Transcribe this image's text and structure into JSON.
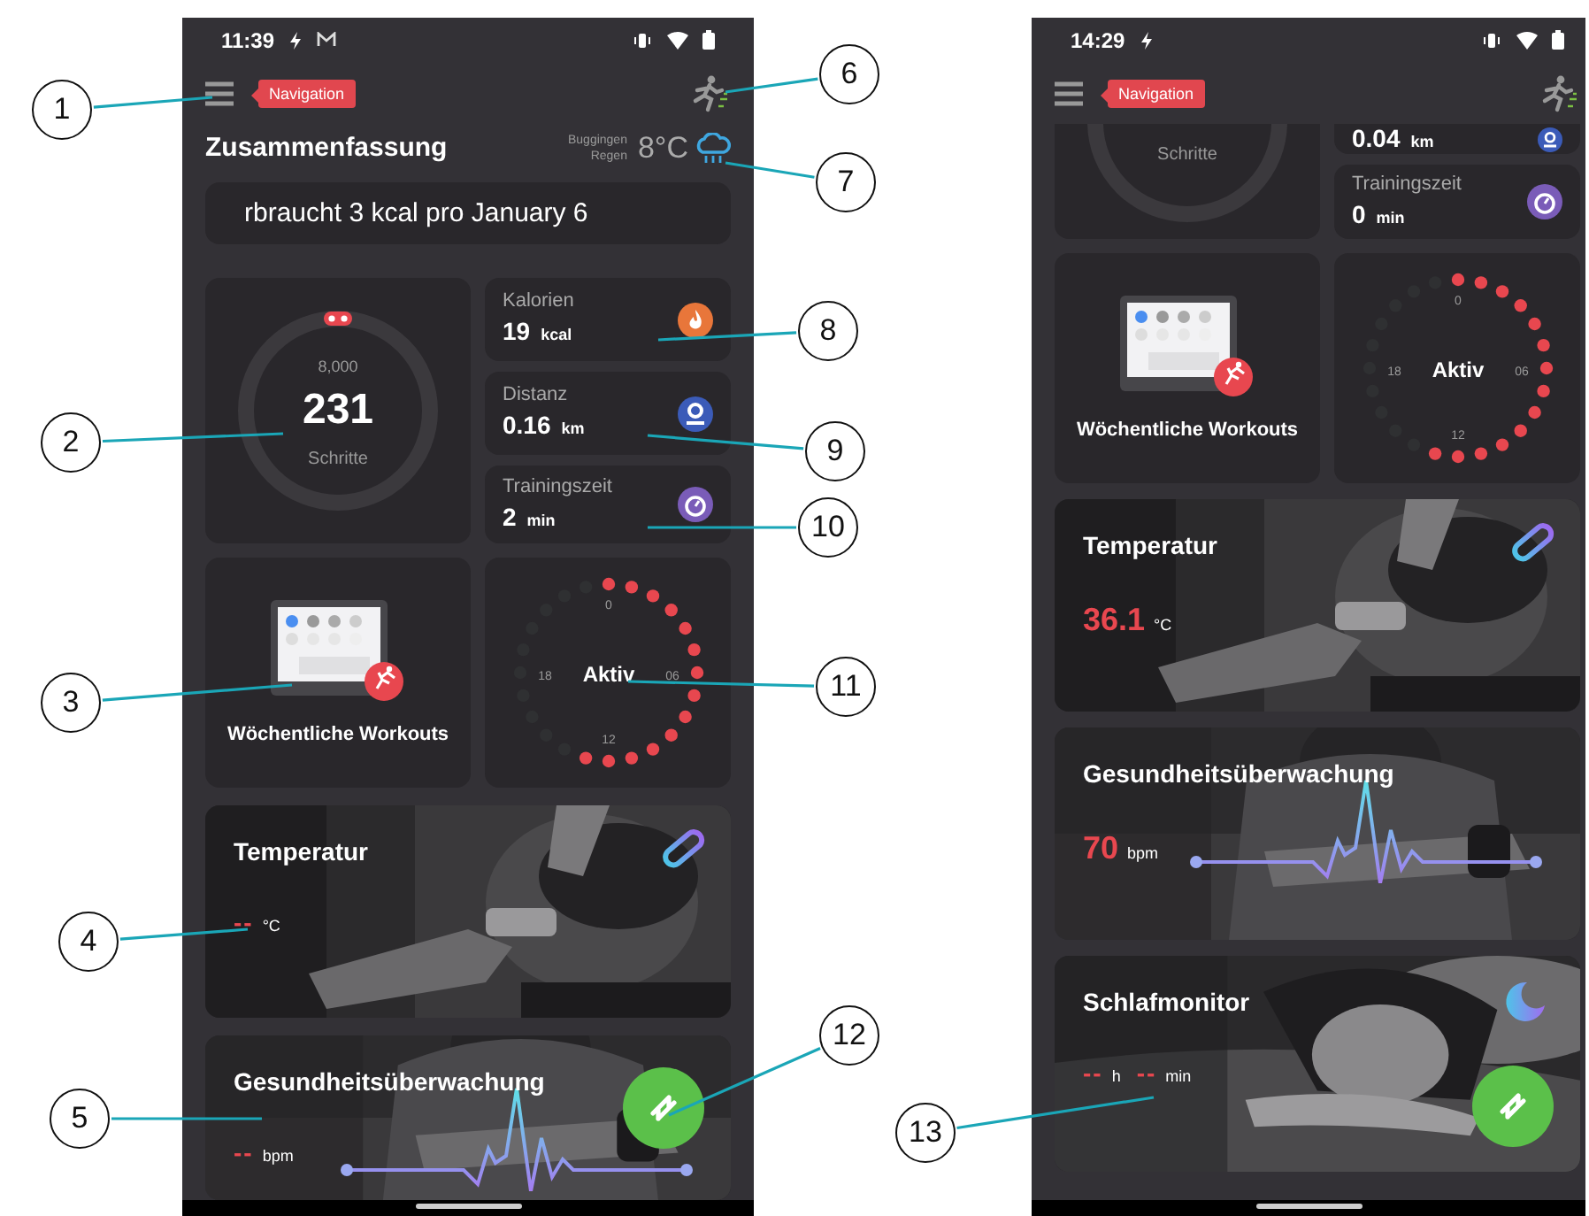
{
  "screens": [
    {
      "status_bar": {
        "time": "11:39",
        "mail_notification": true
      },
      "header": {
        "navigation_hint": "Navigation"
      },
      "title": "Zusammenfassung",
      "weather": {
        "location": "Buggingen",
        "condition": "Regen",
        "temperature": "8°C"
      },
      "banner": "rbraucht 3 kcal pro January 6",
      "summary": {
        "kind": "full",
        "steps": {
          "goal": "8,000",
          "value": "231",
          "label": "Schritte",
          "marker": true
        },
        "metrics": [
          {
            "kind": "calories",
            "label": "Kalorien",
            "value": "19",
            "unit": "kcal"
          },
          {
            "kind": "distance",
            "label": "Distanz",
            "value": "0.16",
            "unit": "km"
          },
          {
            "kind": "duration",
            "label": "Trainingszeit",
            "value": "2",
            "unit": "min"
          }
        ]
      },
      "workouts": {
        "label": "Wöchentliche Workouts"
      },
      "activity": {
        "label": "Aktiv",
        "ticks": [
          "0",
          "06",
          "12",
          "18"
        ],
        "level": 0.58
      },
      "health_cards": [
        {
          "kind": "temperature",
          "title": "Temperatur",
          "readings": [
            {
              "value": "--",
              "unit": "°C"
            }
          ],
          "sync_button": false
        },
        {
          "kind": "heart",
          "title": "Gesundheitsüberwachung",
          "readings": [
            {
              "value": "--",
              "unit": "bpm"
            }
          ],
          "sync_button": true
        }
      ]
    },
    {
      "status_bar": {
        "time": "14:29",
        "mail_notification": false
      },
      "header": {
        "navigation_hint": "Navigation"
      },
      "summary": {
        "kind": "scrolled",
        "steps": {
          "label": "Schritte"
        },
        "metrics": [
          {
            "kind": "distance",
            "value": "0.04",
            "unit": "km"
          },
          {
            "kind": "duration",
            "label": "Trainingszeit",
            "value": "0",
            "unit": "min"
          }
        ]
      },
      "workouts": {
        "label": "Wöchentliche Workouts"
      },
      "activity": {
        "label": "Aktiv",
        "ticks": [
          "0",
          "06",
          "12",
          "18"
        ],
        "level": 0.58
      },
      "health_cards": [
        {
          "kind": "temperature",
          "title": "Temperatur",
          "readings": [
            {
              "value": "36.1",
              "unit": "°C"
            }
          ],
          "sync_button": false
        },
        {
          "kind": "heart",
          "title": "Gesundheitsüberwachung",
          "readings": [
            {
              "value": "70",
              "unit": "bpm"
            }
          ],
          "sync_button": false
        },
        {
          "kind": "sleep",
          "title": "Schlafmonitor",
          "readings": [
            {
              "value": "--",
              "unit": "h"
            },
            {
              "value": "--",
              "unit": "min"
            }
          ],
          "sync_button": true
        }
      ]
    }
  ],
  "callouts": [
    "1",
    "2",
    "3",
    "4",
    "5",
    "6",
    "7",
    "8",
    "9",
    "10",
    "11",
    "12",
    "13"
  ]
}
